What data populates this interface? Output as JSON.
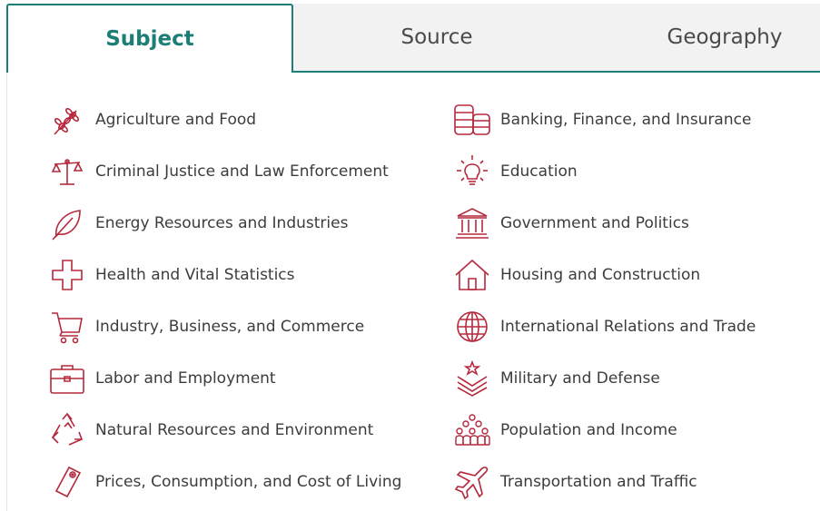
{
  "tabs": [
    {
      "label": "Subject",
      "active": true
    },
    {
      "label": "Source",
      "active": false
    },
    {
      "label": "Geography",
      "active": false
    }
  ],
  "accent_color": "#1b7f76",
  "icon_color": "#b5283c",
  "subjects": {
    "left": [
      {
        "label": "Agriculture and Food",
        "icon": "wheat-icon"
      },
      {
        "label": "Criminal Justice and Law Enforcement",
        "icon": "scales-icon"
      },
      {
        "label": "Energy Resources and Industries",
        "icon": "leaf-icon"
      },
      {
        "label": "Health and Vital Statistics",
        "icon": "medical-cross-icon"
      },
      {
        "label": "Industry, Business, and Commerce",
        "icon": "shopping-cart-icon"
      },
      {
        "label": "Labor and Employment",
        "icon": "briefcase-icon"
      },
      {
        "label": "Natural Resources and Environment",
        "icon": "recycle-icon"
      },
      {
        "label": "Prices, Consumption, and Cost of Living",
        "icon": "price-tag-icon"
      }
    ],
    "right": [
      {
        "label": "Banking, Finance, and Insurance",
        "icon": "coin-stacks-icon"
      },
      {
        "label": "Education",
        "icon": "lightbulb-icon"
      },
      {
        "label": "Government and Politics",
        "icon": "government-building-icon"
      },
      {
        "label": "Housing and Construction",
        "icon": "house-icon"
      },
      {
        "label": "International Relations and Trade",
        "icon": "globe-icon"
      },
      {
        "label": "Military and Defense",
        "icon": "military-chevron-icon"
      },
      {
        "label": "Population and Income",
        "icon": "people-group-icon"
      },
      {
        "label": "Transportation and Traffic",
        "icon": "airplane-icon"
      }
    ]
  }
}
